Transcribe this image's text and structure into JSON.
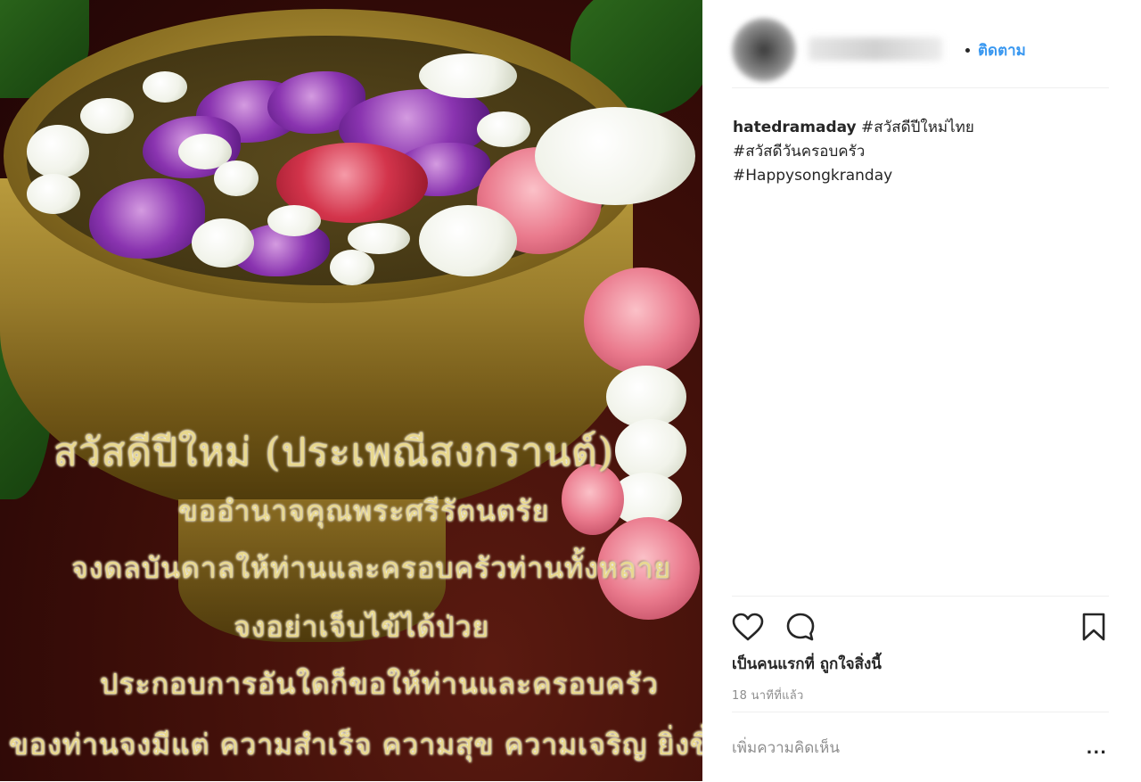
{
  "post": {
    "image": {
      "poem_lines": [
        "สวัสดีปีใหม่ (ประเพณีสงกรานต์)",
        "ขออำนาจคุณพระศรีรัตนตรัย",
        "จงดลบันดาลให้ท่านและครอบครัวท่านทั้งหลาย",
        "จงอย่าเจ็บไข้ได้ป่วย",
        "ประกอบการอันใดก็ขอให้ท่านและครอบครัว",
        "ของท่านจงมีแต่ ความสำเร็จ ความสุข ความเจริญ ยิ่งขึ้นๆ"
      ]
    },
    "header": {
      "follow_label": "ติดตาม"
    },
    "caption": {
      "username": "hatedramaday",
      "lines": [
        "#สวัสดีปีใหม่ไทย",
        "#สวัสดีวันครอบครัว",
        "#Happysongkranday"
      ]
    },
    "actions": {
      "like_icon": "heart-icon",
      "comment_icon": "comment-bubble-icon",
      "save_icon": "bookmark-icon",
      "likes_text": "เป็นคนแรกที่ ถูกใจสิ่งนี้",
      "timestamp": "18 นาทีที่แล้ว"
    },
    "comment": {
      "placeholder": "เพิ่มความคิดเห็น",
      "more_label": "..."
    }
  }
}
